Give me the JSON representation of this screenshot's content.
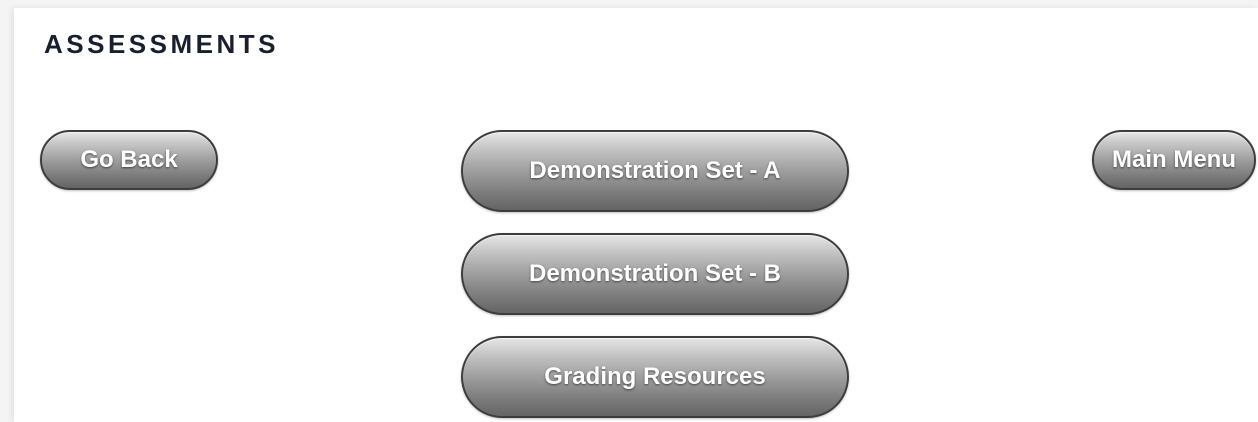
{
  "header": {
    "title": "ASSESSMENTS"
  },
  "nav": {
    "go_back_label": "Go Back",
    "main_menu_label": "Main Menu"
  },
  "menu": {
    "items": [
      {
        "label": "Demonstration Set - A"
      },
      {
        "label": "Demonstration Set - B"
      },
      {
        "label": "Grading Resources"
      }
    ]
  },
  "colors": {
    "title": "#1a1f2e",
    "button_top": "#e6e6e6",
    "button_bottom": "#646464",
    "button_border": "#3d3d3d",
    "button_text": "#ffffff"
  }
}
